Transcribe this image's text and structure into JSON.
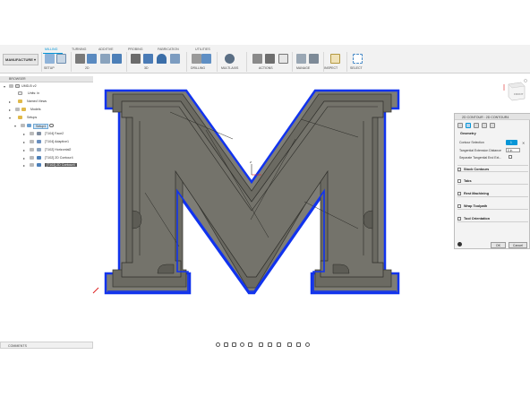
{
  "workspace": {
    "label": "MANUFACTURE"
  },
  "tabs": [
    "MILLING",
    "TURNING",
    "ADDITIVE",
    "PROBING",
    "FABRICATION",
    "UTILITIES"
  ],
  "toolbar_groups": [
    "SETUP",
    "2D",
    "3D",
    "DRILLING",
    "MULTI-AXIS",
    "ACTIONS",
    "MANAGE",
    "INSPECT",
    "SELECT"
  ],
  "browser": {
    "title": "BROWSER",
    "document": "UMD-B v2",
    "units": "Units: in",
    "named_views": "Named Views",
    "models": "Models",
    "setups": "Setups",
    "setup1": "Setup1",
    "operations": [
      "[T104] Face2",
      "[T104] Adaptive1",
      "[T102] Horizontal2",
      "[T102] 2D Contour4",
      "[T102] 2D Contour4"
    ]
  },
  "viewcube": {
    "face": "FRONT"
  },
  "panel": {
    "title": "2D CONTOUR : 2D CONTOUR4",
    "geometry_section": "Geometry",
    "contour_selection_label": "Contour Selection",
    "contour_selection_value": "1",
    "tangential_label": "Tangential Extension Distance",
    "tangential_value": "0 in",
    "separate_label": "Separate Tangential End Ext...",
    "sections": [
      "Stock Contours",
      "Tabs",
      "Rest Machining",
      "Wrap Toolpath",
      "Tool Orientation"
    ],
    "ok": "OK",
    "cancel": "Cancel"
  },
  "comments": {
    "label": "COMMENTS"
  },
  "colors": {
    "accent": "#0696d7",
    "model_fill": "#6b6a62",
    "contour": "#1133ee"
  }
}
